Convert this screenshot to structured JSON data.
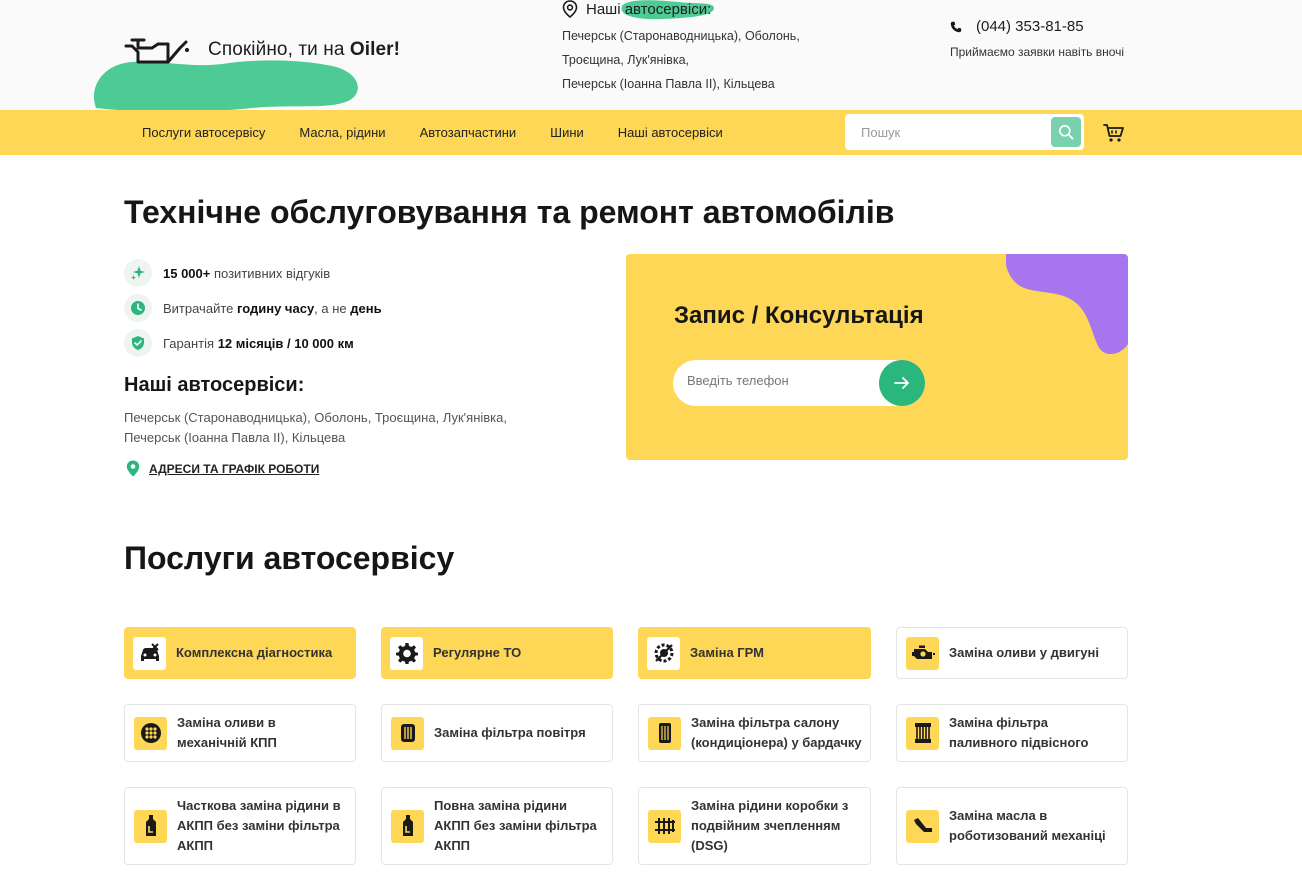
{
  "header": {
    "tagline": "Спокійно, ти на ",
    "brand": "Oiler!",
    "locations_title": "Наші автосервіси:",
    "locations_lines": [
      "Печерськ (Старонаводницька), Оболонь,",
      "Троєщина, Лук'янівка,",
      "Печерськ (Іоанна Павла ІІ), Кільцева"
    ],
    "phone": "(044) 353-81-85",
    "phone_note": "Приймаємо заявки навіть вночі"
  },
  "nav": {
    "items": [
      "Послуги автосервісу",
      "Масла, рідини",
      "Автозапчастини",
      "Шини",
      "Наші автосервіси"
    ],
    "search_placeholder": "Пошук"
  },
  "hero": {
    "title": "Технічне обслуговування та ремонт автомобілів",
    "features": [
      {
        "bold": "15 000+",
        "text": " позитивних відгуків"
      },
      {
        "pre": "Витрачайте ",
        "bold": "годину часу",
        "mid": ", а не ",
        "bold2": "день"
      },
      {
        "pre": "Гарантія ",
        "bold": "12 місяців / 10 000 км"
      }
    ],
    "services_title": "Наші автосервіси:",
    "services_addresses": "Печерськ (Старонаводницька), Оболонь, Троєщина, Лук'янівка, Печерськ (Іоанна Павла ІІ), Кільцева",
    "addresses_link": "АДРЕСИ ТА ГРАФІК РОБОТИ"
  },
  "consult": {
    "title": "Запис / Консультація",
    "phone_placeholder": "Введіть телефон"
  },
  "services": {
    "heading": "Послуги автосервісу",
    "items": [
      {
        "label": "Комплексна діагностика",
        "icon": "car-diagnostics-icon",
        "highlight": true
      },
      {
        "label": "Регулярне ТО",
        "icon": "gear-icon",
        "highlight": true
      },
      {
        "label": "Заміна ГРМ",
        "icon": "timing-gear-icon",
        "highlight": true
      },
      {
        "label": "Заміна оливи у двигуні",
        "icon": "engine-oil-icon",
        "highlight": false
      },
      {
        "label": "Заміна оливи в механічній КПП",
        "icon": "gearbox-icon",
        "highlight": false
      },
      {
        "label": "Заміна фільтра повітря",
        "icon": "air-filter-icon",
        "highlight": false
      },
      {
        "label": "Заміна фільтра салону (кондиціонера) у бардачку",
        "icon": "cabin-filter-icon",
        "highlight": false
      },
      {
        "label": "Заміна фільтра паливного підвісного",
        "icon": "fuel-filter-icon",
        "highlight": false
      },
      {
        "label": "Часткова заміна рідини в АКПП без заміни фільтра АКПП",
        "icon": "fluid-bottle-icon",
        "highlight": false
      },
      {
        "label": "Повна заміна рідини АКПП без заміни фільтра АКПП",
        "icon": "fluid-bottle-icon",
        "highlight": false
      },
      {
        "label": "Заміна рідини коробки з подвійним зчепленням (DSG)",
        "icon": "dsg-gearbox-icon",
        "highlight": false
      },
      {
        "label": "Заміна масла в роботизований механіці",
        "icon": "oil-can-icon",
        "highlight": false
      }
    ]
  },
  "colors": {
    "accent_yellow": "#fdd755",
    "accent_green": "#2bb67d",
    "blob_green": "#4ecb94",
    "blob_purple": "#a775ee"
  }
}
